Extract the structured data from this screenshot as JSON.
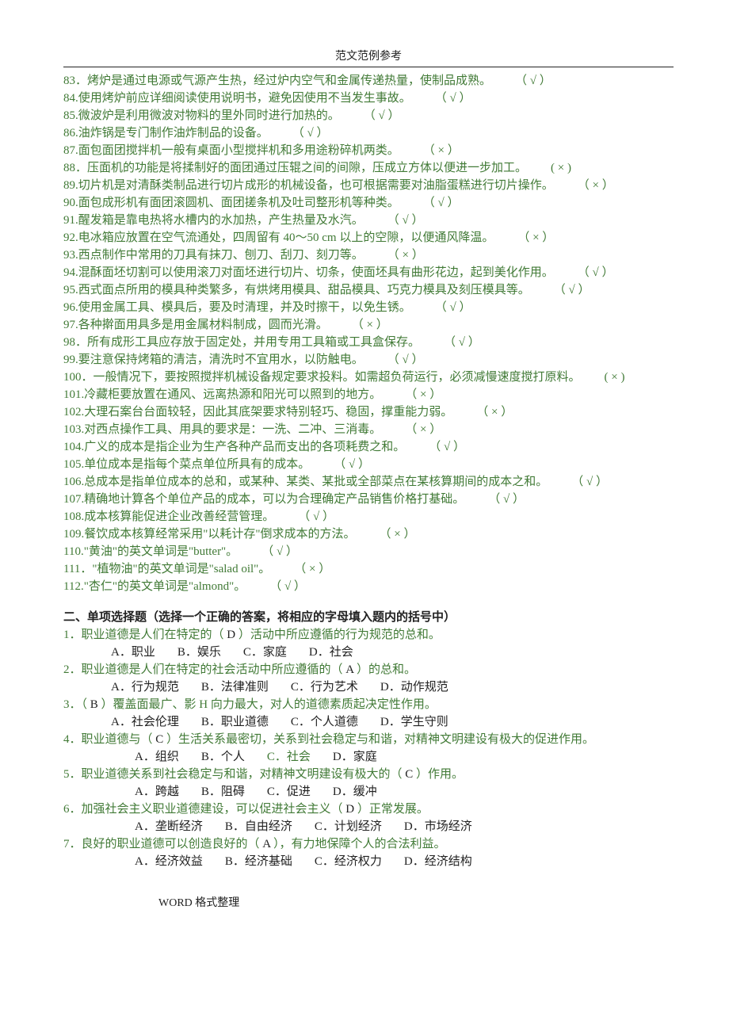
{
  "header": {
    "title": "范文范例参考"
  },
  "tf_items": [
    {
      "n": "83．",
      "text": "烤炉是通过电源或气源产生热，经过炉内空气和金属传递热量，使制品成熟。",
      "mark": "（ √ ）"
    },
    {
      "n": "84.",
      "text": "使用烤炉前应详细阅读使用说明书，避免因使用不当发生事故。",
      "mark": "（ √ ）"
    },
    {
      "n": "85.",
      "text": "微波炉是利用微波对物料的里外同时进行加热的。",
      "mark": "（ √ ）"
    },
    {
      "n": "86.",
      "text": "油炸锅是专门制作油炸制品的设备。",
      "mark": "（ √ ）"
    },
    {
      "n": "87.",
      "text": "面包面团搅拌机一般有桌面小型搅拌机和多用途粉碎机两类。",
      "mark": "（ × ）"
    },
    {
      "n": "88．",
      "text": "压面机的功能是将揉制好的面团通过压辊之间的间隙，压成立方体以便进一步加工。",
      "mark": "( × )"
    },
    {
      "n": "89.",
      "text": "切片机是对清酥类制品进行切片成形的机械设备，也可根据需要对油脂蛋糕进行切片操作。",
      "mark": "（ × ）"
    },
    {
      "n": "90.",
      "text": "面包成形机有面团滚圆机、面团搓条机及吐司整形机等种类。",
      "mark": "（ √ ）"
    },
    {
      "n": "91.",
      "text": "醒发箱是靠电热将水槽内的水加热，产生热量及水汽。",
      "mark": "（ √ ）"
    },
    {
      "n": "92.",
      "text": "电冰箱应放置在空气流通处，四周留有 40～50 cm 以上的空隙，以便通风降温。",
      "mark": "（ × ）"
    },
    {
      "n": "93.",
      "text": "西点制作中常用的刀具有抹刀、刨刀、刮刀、刻刀等。",
      "mark": "（ × ）"
    },
    {
      "n": "94.",
      "text": "混酥面坯切割可以使用滚刀对面坯进行切片、切条，使面坯具有曲形花边，起到美化作用。",
      "mark": "（ √ ）"
    },
    {
      "n": "95.",
      "text": "西式面点所用的模具种类繁多，有烘烤用模具、甜品模具、巧克力模具及刻压模具等。",
      "mark": "（ √ ）"
    },
    {
      "n": "96.",
      "text": "使用金属工具、模具后，要及时清理，并及时擦干，以免生锈。",
      "mark": "（ √ ）"
    },
    {
      "n": "97.",
      "text": "各种擀面用具多是用金属材料制成，圆而光滑。",
      "mark": "（ × ）"
    },
    {
      "n": "98．",
      "text": "所有成形工具应存放于固定处，并用专用工具箱或工具盒保存。",
      "mark": "（ √ ）"
    },
    {
      "n": "99.",
      "text": "要注意保持烤箱的清洁，清洗时不宜用水，以防触电。",
      "mark": "（ √ ）"
    },
    {
      "n": "100．",
      "text": "一般情况下，要按照搅拌机械设备规定要求投料。如需超负荷运行，必须减慢速度搅打原料。",
      "mark": "( × )"
    },
    {
      "n": "101.",
      "text": "冷藏柜要放置在通风、远离热源和阳光可以照到的地方。",
      "mark": "（ × ）"
    },
    {
      "n": "102.",
      "text": "大理石案台台面较轻，因此其底架要求特别轻巧、稳固，撑重能力弱。",
      "mark": "（ × ）"
    },
    {
      "n": "103.",
      "text": "对西点操作工具、用具的要求是：一洗、二冲、三消毒。",
      "mark": "（ × ）"
    },
    {
      "n": "104.",
      "text": "广义的成本是指企业为生产各种产品而支出的各项耗费之和。",
      "mark": "（ √ ）"
    },
    {
      "n": "105.",
      "text": "单位成本是指每个菜点单位所具有的成本。",
      "mark": "（ √ ）"
    },
    {
      "n": "106.",
      "text": "总成本是指单位成本的总和，或某种、某类、某批或全部菜点在某核算期间的成本之和。",
      "mark": "（ √ ）"
    },
    {
      "n": "107.",
      "text": "精确地计算各个单位产品的成本，可以为合理确定产品销售价格打基础。",
      "mark": "（ √ ）"
    },
    {
      "n": "108.",
      "text": "成本核算能促进企业改善经营管理。",
      "mark": "（ √ ）"
    },
    {
      "n": "109.",
      "text": "餐饮成本核算经常采用\"以耗计存\"倒求成本的方法。",
      "mark": "（ × ）"
    },
    {
      "n": "110.",
      "text": "\"黄油\"的英文单词是\"butter\"。",
      "mark": "（ √ ）"
    },
    {
      "n": "111．",
      "text": "\"植物油\"的英文单词是\"salad oil\"。",
      "mark": "（ × ）"
    },
    {
      "n": "112.",
      "text": "\"杏仁\"的英文单词是\"almond\"。",
      "mark": "（ √ ）"
    }
  ],
  "mc_section_title": "二、单项选择题（选择一个正确的答案，将相应的字母填入题内的括号中）",
  "mc_items": [
    {
      "n": "1．",
      "pre": "职业道德是人们在特定的（",
      "ans": " D ",
      "post": "）活动中所应遵循的行为规范的总和。",
      "opts": [
        {
          "label": "A．职业",
          "color": "black"
        },
        {
          "label": "B．娱乐",
          "color": "black"
        },
        {
          "label": "C．家庭",
          "color": "black"
        },
        {
          "label": "D．社会",
          "color": "black"
        }
      ],
      "indent": "indent-a"
    },
    {
      "n": "2．",
      "pre": "职业道德是人们在特定的社会活动中所应遵循的（",
      "ans": " A  ",
      "post": "）的总和。",
      "opts": [
        {
          "label": "A．行为规范",
          "color": "black"
        },
        {
          "label": "B．法律准则",
          "color": "black"
        },
        {
          "label": "C．行为艺术",
          "color": "black"
        },
        {
          "label": "D．动作规范",
          "color": "black"
        }
      ],
      "indent": "indent-a"
    },
    {
      "n": "3．",
      "pre": "（",
      "ans": " B ",
      "post": "）覆盖面最广、影 H 向力最大，对人的道德素质起决定性作用。",
      "opts": [
        {
          "label": "A．社会伦理",
          "color": "black"
        },
        {
          "label": "B．职业道德",
          "color": "black"
        },
        {
          "label": "C．个人道德",
          "color": "black"
        },
        {
          "label": "D．学生守则",
          "color": "black"
        }
      ],
      "indent": "indent-a"
    },
    {
      "n": "4．",
      "pre": "职业道德与（",
      "ans": " C ",
      "post": "）生活关系最密切，关系到社会稳定与和谐，对精神文明建设有极大的促进作用。",
      "opts": [
        {
          "label": "A．组织",
          "color": "black"
        },
        {
          "label": "B．个人",
          "color": "black"
        },
        {
          "label": "C．社会",
          "color": "green"
        },
        {
          "label": "D．家庭",
          "color": "black"
        }
      ],
      "indent": "mc-opts"
    },
    {
      "n": "5．",
      "pre": "职业道德关系到社会稳定与和谐，对精神文明建设有极大的（",
      "ans": " C  ",
      "post": "）作用。",
      "opts": [
        {
          "label": "A．跨越",
          "color": "black"
        },
        {
          "label": "B．阻碍",
          "color": "black"
        },
        {
          "label": "C．促进",
          "color": "black"
        },
        {
          "label": "D．缓冲",
          "color": "black"
        }
      ],
      "indent": "mc-opts"
    },
    {
      "n": "6．",
      "pre": "加强社会主义职业道德建设，可以促进社会主义（",
      "ans": " D   ",
      "post": "）正常发展。",
      "opts": [
        {
          "label": "A．垄断经济",
          "color": "black"
        },
        {
          "label": "B．自由经济",
          "color": "black"
        },
        {
          "label": "C．计划经济",
          "color": "black"
        },
        {
          "label": "D．市场经济",
          "color": "black"
        }
      ],
      "indent": "mc-opts"
    },
    {
      "n": "7．",
      "pre": "良好的职业道德可以创造良好的（",
      "ans": "  A  ",
      "post": "），有力地保障个人的合法利益。",
      "opts": [
        {
          "label": "A．经济效益",
          "color": "black"
        },
        {
          "label": "B．经济基础",
          "color": "black"
        },
        {
          "label": "C．经济权力",
          "color": "black"
        },
        {
          "label": "D．经济结构",
          "color": "black"
        }
      ],
      "indent": "mc-opts"
    }
  ],
  "footer": {
    "text": "WORD 格式整理"
  }
}
